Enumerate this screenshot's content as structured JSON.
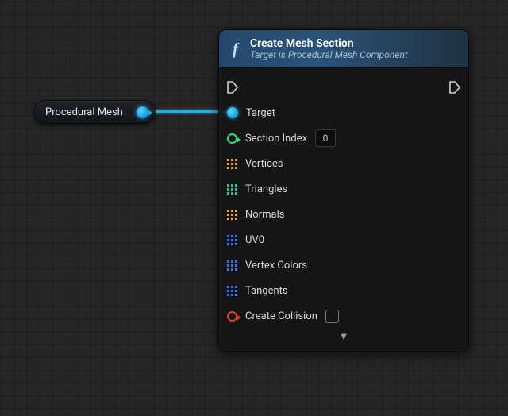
{
  "source_node": {
    "label": "Procedural Mesh",
    "pin_color": "#1aa7e0"
  },
  "node": {
    "icon": "f",
    "title": "Create Mesh Section",
    "subtitle": "Target is Procedural Mesh Component",
    "inputs": {
      "target": {
        "label": "Target"
      },
      "section_index": {
        "label": "Section Index",
        "value": "0"
      },
      "vertices": {
        "label": "Vertices"
      },
      "triangles": {
        "label": "Triangles"
      },
      "normals": {
        "label": "Normals"
      },
      "uv0": {
        "label": "UV0"
      },
      "vertex_colors": {
        "label": "Vertex Colors"
      },
      "tangents": {
        "label": "Tangents"
      },
      "create_collision": {
        "label": "Create Collision",
        "checked": false
      }
    }
  }
}
